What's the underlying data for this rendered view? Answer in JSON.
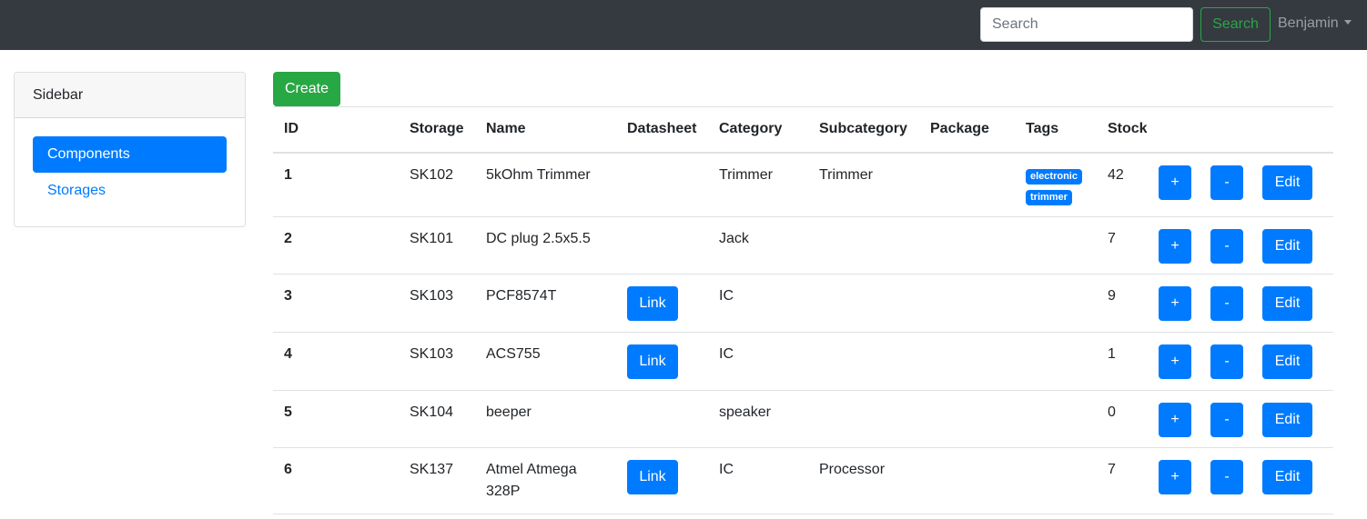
{
  "navbar": {
    "search_placeholder": "Search",
    "search_button": "Search",
    "user": "Benjamin"
  },
  "sidebar": {
    "title": "Sidebar",
    "items": [
      {
        "label": "Components",
        "active": true
      },
      {
        "label": "Storages",
        "active": false
      }
    ]
  },
  "create_label": "Create",
  "table": {
    "headers": [
      "ID",
      "Storage",
      "Name",
      "Datasheet",
      "Category",
      "Subcategory",
      "Package",
      "Tags",
      "Stock"
    ],
    "rows": [
      {
        "id": "1",
        "storage": "SK102",
        "name": "5kOhm Trimmer",
        "datasheet": "",
        "category": "Trimmer",
        "subcategory": "Trimmer",
        "package": "",
        "tags": [
          "electronic",
          "trimmer"
        ],
        "stock": "42"
      },
      {
        "id": "2",
        "storage": "SK101",
        "name": "DC plug 2.5x5.5",
        "datasheet": "",
        "category": "Jack",
        "subcategory": "",
        "package": "",
        "tags": [],
        "stock": "7"
      },
      {
        "id": "3",
        "storage": "SK103",
        "name": "PCF8574T",
        "datasheet": "Link",
        "category": "IC",
        "subcategory": "",
        "package": "",
        "tags": [],
        "stock": "9"
      },
      {
        "id": "4",
        "storage": "SK103",
        "name": "ACS755",
        "datasheet": "Link",
        "category": "IC",
        "subcategory": "",
        "package": "",
        "tags": [],
        "stock": "1"
      },
      {
        "id": "5",
        "storage": "SK104",
        "name": "beeper",
        "datasheet": "",
        "category": "speaker",
        "subcategory": "",
        "package": "",
        "tags": [],
        "stock": "0"
      },
      {
        "id": "6",
        "storage": "SK137",
        "name": "Atmel Atmega 328P",
        "datasheet": "Link",
        "category": "IC",
        "subcategory": "Processor",
        "package": "",
        "tags": [],
        "stock": "7"
      }
    ],
    "actions": {
      "plus": "+",
      "minus": "-",
      "edit": "Edit"
    }
  },
  "colors": {
    "navbar": "#343a40",
    "primary": "#007bff",
    "success": "#28a745"
  }
}
